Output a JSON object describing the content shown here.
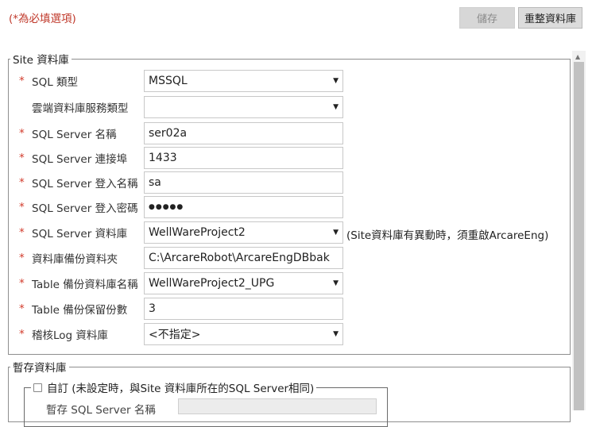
{
  "header": {
    "required_note": "(*為必填選項)",
    "save_label": "儲存",
    "reset_label": "重整資料庫"
  },
  "site_db": {
    "legend": "Site 資料庫",
    "sql_type": {
      "star": "*",
      "label": "SQL 類型",
      "value": "MSSQL"
    },
    "cloud_service_type": {
      "label": "雲端資料庫服務類型",
      "value": ""
    },
    "server_name": {
      "star": "*",
      "label": "SQL Server 名稱",
      "value": "ser02a"
    },
    "server_port": {
      "star": "*",
      "label": "SQL Server 連接埠",
      "value": "1433"
    },
    "login_name": {
      "star": "*",
      "label": "SQL Server 登入名稱",
      "value": "sa"
    },
    "login_password": {
      "star": "*",
      "label": "SQL Server 登入密碼",
      "value": "●●●●●"
    },
    "database": {
      "star": "*",
      "label": "SQL Server 資料庫",
      "value": "WellWareProject2",
      "note": "(Site資料庫有異動時，須重啟ArcareEng)"
    },
    "backup_folder": {
      "star": "*",
      "label": "資料庫備份資料夾",
      "value": "C:\\ArcareRobot\\ArcareEngDBbak"
    },
    "table_backup_db": {
      "star": "*",
      "label": "Table 備份資料庫名稱",
      "value": "WellWareProject2_UPG"
    },
    "table_backup_count": {
      "star": "*",
      "label": "Table 備份保留份數",
      "value": "3"
    },
    "audit_log_db": {
      "star": "*",
      "label": "稽核Log 資料庫",
      "value": "<不指定>"
    }
  },
  "temp_db": {
    "legend": "暫存資料庫",
    "custom_label": "自訂 (未設定時，與Site 資料庫所在的SQL Server相同)",
    "server_name_label": "暫存 SQL Server 名稱"
  },
  "icons": {
    "dropdown": "chevron-down-icon",
    "scroll_up": "arrow-up-icon"
  }
}
